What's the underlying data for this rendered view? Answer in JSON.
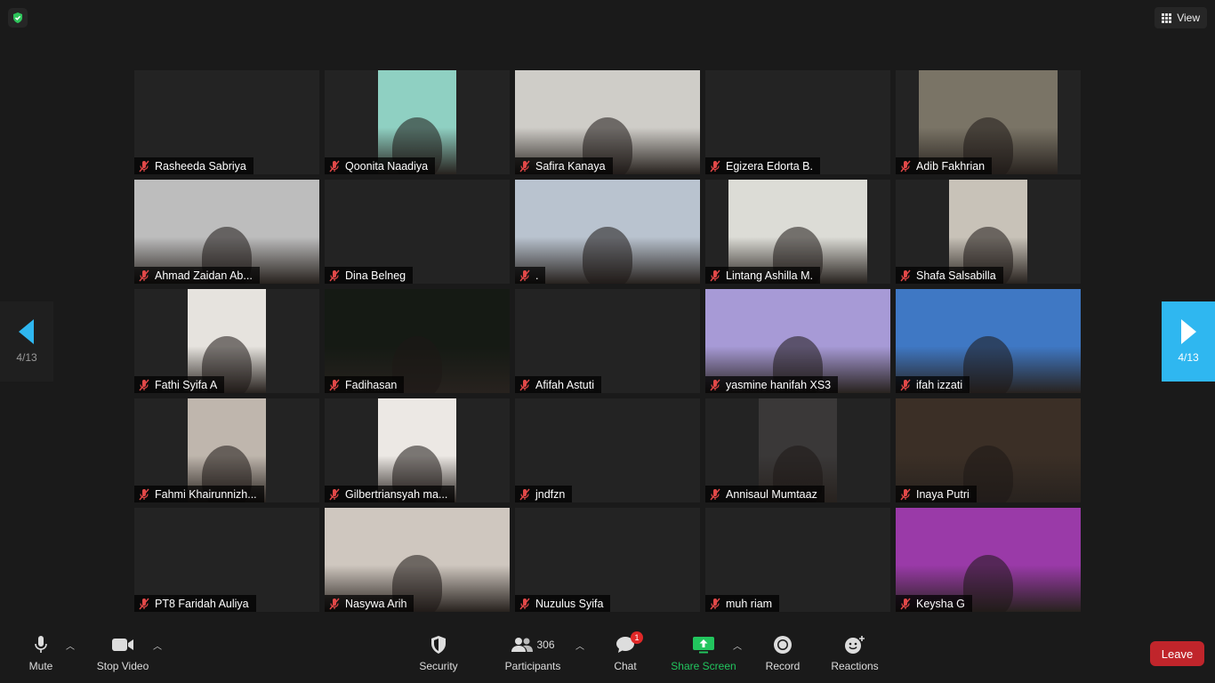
{
  "topbar": {
    "view_label": "View"
  },
  "participants": [
    {
      "name": "Rasheeda Sabriya",
      "video": null
    },
    {
      "name": "Qoonita Naadiya",
      "video": {
        "color": "#8fd0c2"
      }
    },
    {
      "name": "Safira Kanaya",
      "video": {
        "color": "#cfcdc8"
      }
    },
    {
      "name": "Egizera Edorta B.",
      "video": null
    },
    {
      "name": "Adib Fakhrian",
      "video": {
        "color": "#7a7466"
      }
    },
    {
      "name": "Ahmad Zaidan Ab...",
      "video": {
        "color": "#bdbdbd"
      }
    },
    {
      "name": "Dina Belneg",
      "video": null
    },
    {
      "name": ".",
      "video": {
        "color": "#b9c3cf"
      }
    },
    {
      "name": "Lintang Ashilla M.",
      "video": {
        "color": "#dcdcd6"
      }
    },
    {
      "name": "Shafa Salsabilla",
      "video": {
        "color": "#c8c2b8"
      }
    },
    {
      "name": "Fathi Syifa A",
      "video": {
        "color": "#e6e3de"
      }
    },
    {
      "name": "Fadihasan",
      "video": {
        "color": "#151a14"
      }
    },
    {
      "name": "Afifah Astuti",
      "video": null
    },
    {
      "name": "yasmine hanifah XS3",
      "video": {
        "color": "#a79ad6"
      }
    },
    {
      "name": "ifah izzati",
      "video": {
        "color": "#3f78c4"
      }
    },
    {
      "name": "Fahmi Khairunnizh...",
      "video": {
        "color": "#bfb6ad"
      }
    },
    {
      "name": "Gilbertriansyah ma...",
      "video": {
        "color": "#ece8e4"
      }
    },
    {
      "name": "jndfzn",
      "video": null
    },
    {
      "name": "Annisaul Mumtaaz",
      "video": {
        "color": "#3a3838"
      }
    },
    {
      "name": "Inaya Putri",
      "video": {
        "color": "#3b2f26"
      }
    },
    {
      "name": "PT8 Faridah Auliya",
      "video": null
    },
    {
      "name": "Nasywa Arih",
      "video": {
        "color": "#cfc7bf"
      }
    },
    {
      "name": "Nuzulus Syifa",
      "video": null
    },
    {
      "name": "muh riam",
      "video": null
    },
    {
      "name": "Keysha G",
      "video": {
        "color": "#9a3aa8"
      }
    }
  ],
  "pager": {
    "left_label": "4/13",
    "right_label": "4/13"
  },
  "toolbar": {
    "mute_label": "Mute",
    "stop_video_label": "Stop Video",
    "security_label": "Security",
    "participants_label": "Participants",
    "participants_count": "306",
    "chat_label": "Chat",
    "chat_badge": "1",
    "share_screen_label": "Share Screen",
    "record_label": "Record",
    "reactions_label": "Reactions",
    "leave_label": "Leave"
  },
  "colors": {
    "share_green": "#22c55e",
    "leave_red": "#c0252b",
    "pager_blue": "#2fb7f0",
    "shield_green": "#2ec45b",
    "mic_off_red": "#e24848"
  }
}
